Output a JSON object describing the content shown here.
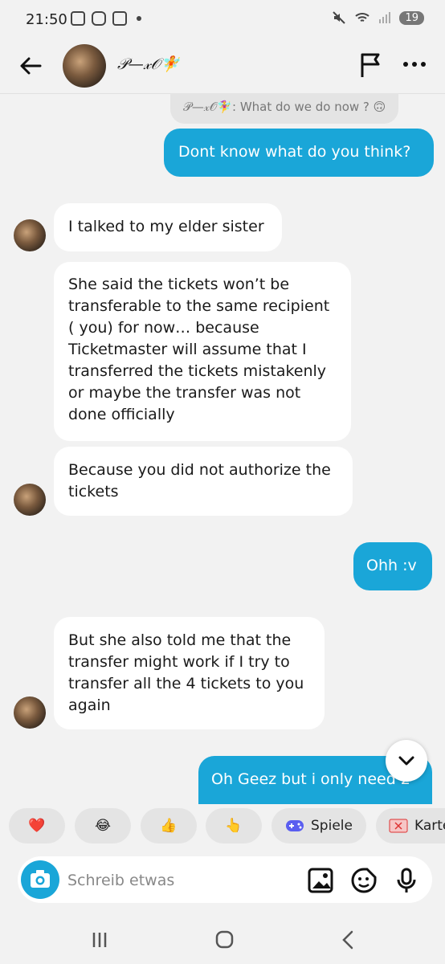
{
  "status_bar": {
    "time": "21:50",
    "battery": "19"
  },
  "header": {
    "contact_name": "𝒫—𝓍𝒪🧚",
    "icons": [
      "back-arrow-icon",
      "flag-icon",
      "more-icon"
    ]
  },
  "reply_quote": {
    "text": "𝒫—𝓍𝒪🧚‍♀️: What do we do now ? 🙃"
  },
  "messages": [
    {
      "side": "out",
      "text": "Dont know what do you think?"
    },
    {
      "side": "in",
      "text": "I talked to my elder sister"
    },
    {
      "side": "in",
      "text": "She said the tickets won’t be transferable to the same recipient ( you) for now… because Ticketmaster will assume that I transferred the tickets mistakenly or maybe the transfer was not done officially"
    },
    {
      "side": "in",
      "text": "Because you did not authorize the tickets"
    },
    {
      "side": "out",
      "text": "Ohh :v"
    },
    {
      "side": "in",
      "text": "But she also told me that the transfer might work if I try to transfer all the 4 tickets to you again"
    },
    {
      "side": "out",
      "text": "Oh Geez but i only need 2"
    }
  ],
  "quick_reactions": {
    "heart": "❤️",
    "laugh": "😂",
    "thumbs": "👍",
    "point": "👆",
    "games_label": "Spiele",
    "cards_label": "Karten"
  },
  "composer": {
    "placeholder": "Schreib etwas"
  },
  "colors": {
    "accent": "#1aa6d8",
    "incoming_bubble": "#ffffff",
    "background": "#f2f2f2"
  }
}
